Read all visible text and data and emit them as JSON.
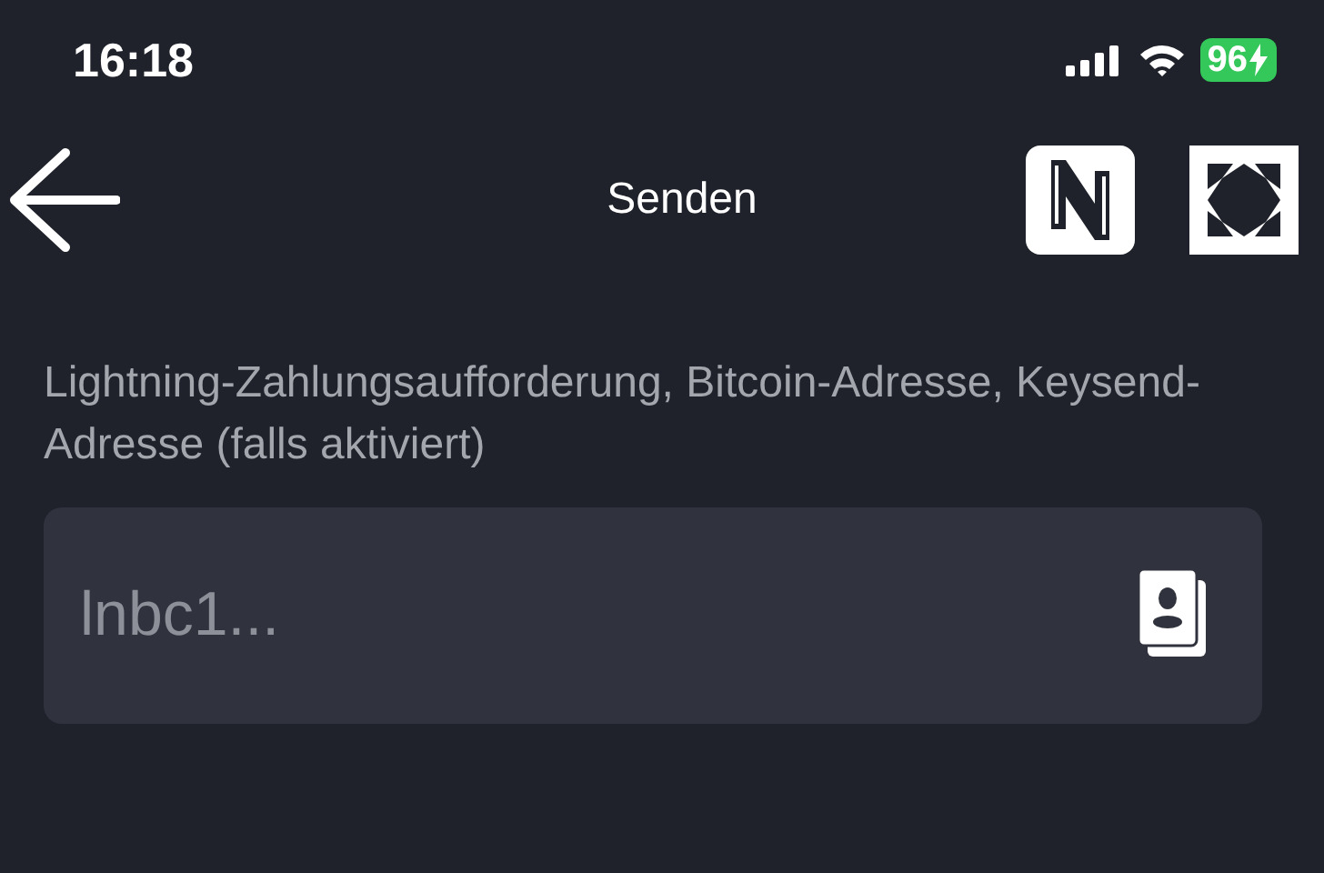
{
  "status_bar": {
    "time": "16:18",
    "battery": "96",
    "charging": true
  },
  "header": {
    "title": "Senden"
  },
  "address": {
    "label": "Lightning-Zahlungsaufforderung, Bitcoin-Adresse, Keysend-Adresse (falls aktiviert)",
    "placeholder": "lnbc1..."
  }
}
